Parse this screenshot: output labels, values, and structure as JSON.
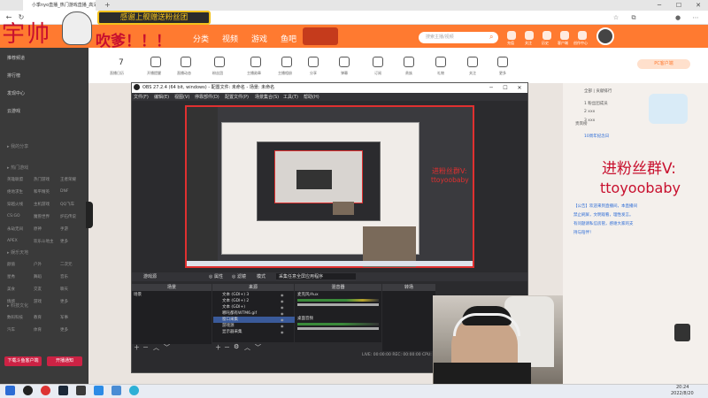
{
  "browser": {
    "tab_title": "小季nyo直播_热门游戏直播_高清...",
    "new_tab": "+",
    "window_controls": [
      "─",
      "☐",
      "✕"
    ]
  },
  "site": {
    "nav": [
      "分类",
      "视频",
      "游戏",
      "鱼吧"
    ],
    "nav_arrow": "⌄",
    "search_placeholder": "搜索主播/视频",
    "header_icons": [
      "充值",
      "关注",
      "历史",
      "客户端",
      "创作中心"
    ],
    "categories": [
      "7",
      "直播日历",
      "开播提醒",
      "直播动态",
      "粉丝团",
      "主播勋章",
      "主播相册",
      "分享",
      "弹幕",
      "订阅",
      "贵族",
      "礼物",
      "关注",
      "更多"
    ],
    "pc_button": "PC客户端"
  },
  "sidebar": {
    "items": [
      "推荐频道",
      "排行榜",
      "发现中心",
      "云游戏"
    ],
    "section1": "▸ 我的分享",
    "section2": "▸ 热门游戏",
    "grid": [
      [
        "英雄联盟",
        "热门游戏",
        "王者荣耀"
      ],
      [
        "绝地求生",
        "和平精英",
        "DNF"
      ],
      [
        "穿越火线",
        "主机游戏",
        "QQ飞车"
      ],
      [
        "CS:GO",
        "魔兽世界",
        "炉石传说"
      ],
      [
        "永劫无间",
        "原神",
        "手游"
      ],
      [
        "APEX",
        "欢乐斗地主",
        "更多"
      ]
    ],
    "section3": "▸ 娱乐天地",
    "grid2": [
      [
        "颜值",
        "户外",
        "二次元"
      ],
      [
        "星秀",
        "舞蹈",
        "音乐"
      ],
      [
        "美食",
        "交友",
        "聊天"
      ],
      [
        "情感",
        "游戏",
        "更多"
      ]
    ],
    "section4": "▸ 科技文化",
    "grid3": [
      [
        "数码科技",
        "教育",
        "军事"
      ],
      [
        "汽车",
        "体育",
        "更多"
      ]
    ],
    "btn_left": "下载斗鱼客户端",
    "btn_right": "开播通知"
  },
  "overlays": {
    "yu": "宇帅",
    "thanks": "感谢上舰赠送粉丝团",
    "blow": "吹爹！！！",
    "fans": "进粉丝群V:",
    "fans_id": "ttoyoobaby"
  },
  "right_panel": {
    "lines": [
      "全部 | 贡献排行",
      "1  粉丝团成员",
      "2  xxx",
      "3  xxx",
      "贵宾榜",
      "10周年纪念日",
      "【公告】欢迎来到直播间，本直播间",
      "禁止刷屏，文明观看，理性发言。",
      "有问题请私信房管，感谢大家的支",
      "持与陪伴！"
    ]
  },
  "obs": {
    "title": "OBS 27.2.4 (64 bit, windows) - 配置文件: 未命名 - 场景: 未命名",
    "menu": [
      "文件(F)",
      "编辑(E)",
      "视图(V)",
      "停靠部件(D)",
      "配置文件(P)",
      "场景集合(S)",
      "工具(T)",
      "帮助(H)"
    ],
    "props_bar": [
      "游戏源",
      "◎ 属性",
      "◎ 滤镜",
      "模式",
      "采集任意全屏应用程序"
    ],
    "docks": [
      "场景",
      "来源",
      "混音器",
      "转场"
    ],
    "scene": "场景",
    "sources": [
      "文本 (GDI+) 3",
      "文本 (GDI+) 2",
      "文本 (GDI+)",
      "哪吒都有WTM6.gif",
      "窗口采集",
      "游戏源",
      "显示器采集"
    ],
    "mixer": [
      "麦克风/Aux",
      "桌面音频"
    ],
    "status": "LIVE: 00:00:00   REC: 00:00:00   CPU: 12%  60.00 fps",
    "preview_text": "进粉丝群V:",
    "preview_id": "ttoyoobaby"
  },
  "taskbar": {
    "time": "20:24",
    "date": "2022/8/20"
  }
}
